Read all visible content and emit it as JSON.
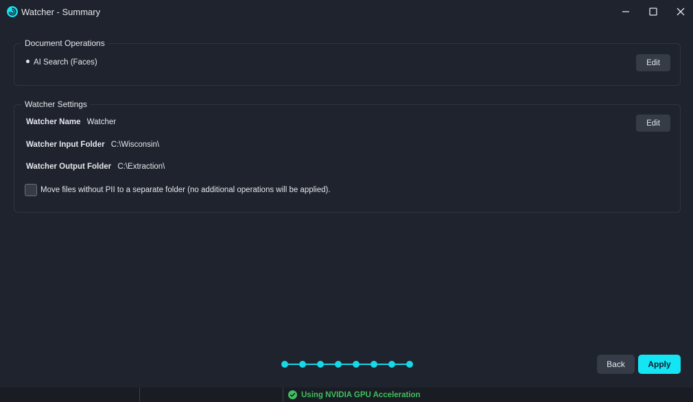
{
  "window": {
    "title": "Watcher - Summary",
    "app_icon": "swirl-logo-icon",
    "controls": [
      "minimize-icon",
      "maximize-icon",
      "close-icon"
    ]
  },
  "document_operations": {
    "title": "Document Operations",
    "items": [
      "AI Search (Faces)"
    ],
    "edit_label": "Edit"
  },
  "watcher_settings": {
    "title": "Watcher Settings",
    "edit_label": "Edit",
    "name_label": "Watcher Name",
    "name_value": "Watcher",
    "input_label": "Watcher Input Folder",
    "input_value": "C:\\Wisconsin\\",
    "output_label": "Watcher Output Folder",
    "output_value": "C:\\Extraction\\",
    "move_files_label": "Move files without PII to a separate folder (no additional operations will be applied).",
    "move_files_checked": false
  },
  "stepper": {
    "total_steps": 8,
    "completed_steps": 8
  },
  "footer": {
    "back_label": "Back",
    "apply_label": "Apply"
  },
  "status_bar": {
    "gpu_text": "Using NVIDIA GPU Acceleration",
    "gpu_icon": "check-circle-icon"
  },
  "colors": {
    "background": "#1f232d",
    "accent": "#14e5f5",
    "success": "#3fbf5f",
    "button": "#353b47"
  }
}
